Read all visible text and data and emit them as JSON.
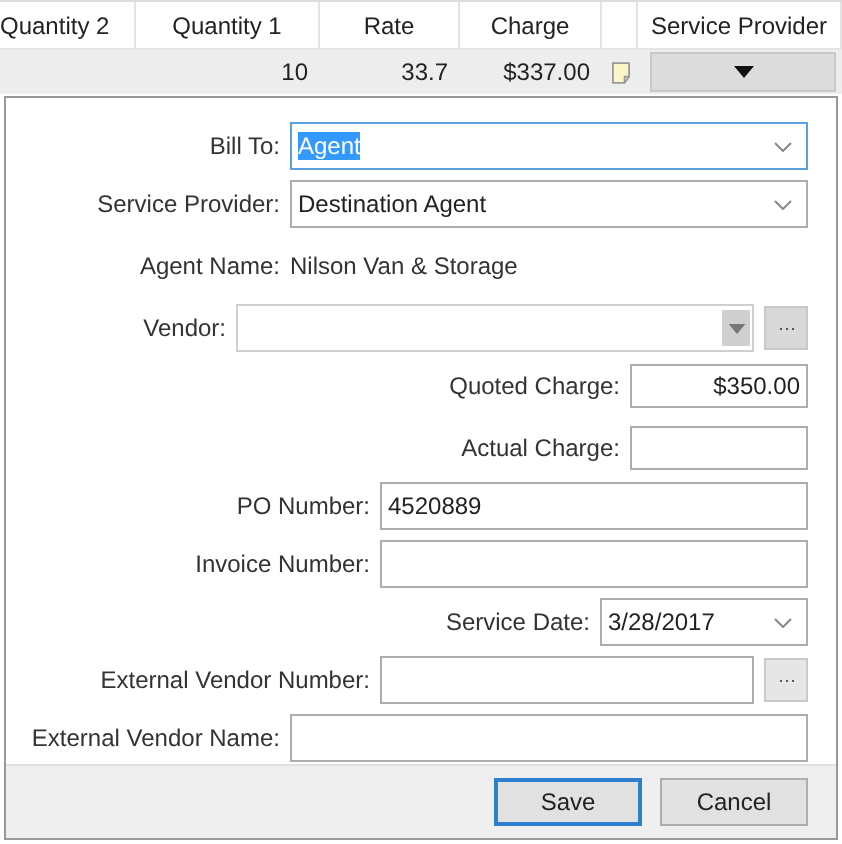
{
  "grid": {
    "columns": [
      "Quantity 2",
      "Quantity 1",
      "Rate",
      "Charge",
      "",
      "Service Provider"
    ],
    "row": {
      "quantity_1": "10",
      "rate": "33.7",
      "charge": "$337.00"
    }
  },
  "form": {
    "fields": [
      {
        "kind": "combo",
        "label": "Bill To:",
        "value": "Agent",
        "value_selected": true
      },
      {
        "kind": "combo",
        "label": "Service Provider:",
        "value": "Destination Agent",
        "value_selected": false
      },
      {
        "kind": "static",
        "label": "Agent Name:",
        "value": "Nilson Van & Storage"
      },
      {
        "kind": "lookup_combo",
        "label": "Vendor:",
        "disabled": true
      },
      {
        "kind": "money",
        "label": "Quoted Charge:",
        "value": "$350.00"
      },
      {
        "kind": "money",
        "label": "Actual Charge:"
      },
      {
        "kind": "text",
        "label": "PO Number:",
        "value": "4520889"
      },
      {
        "kind": "text",
        "label": "Invoice Number:"
      },
      {
        "kind": "date",
        "label": "Service Date:",
        "value": "3/28/2017"
      },
      {
        "kind": "lookup",
        "label": "External Vendor Number:"
      },
      {
        "kind": "text",
        "label": "External Vendor Name:"
      }
    ],
    "buttons": [
      {
        "label": "Save",
        "default": true
      },
      {
        "label": "Cancel",
        "default": false
      }
    ]
  }
}
